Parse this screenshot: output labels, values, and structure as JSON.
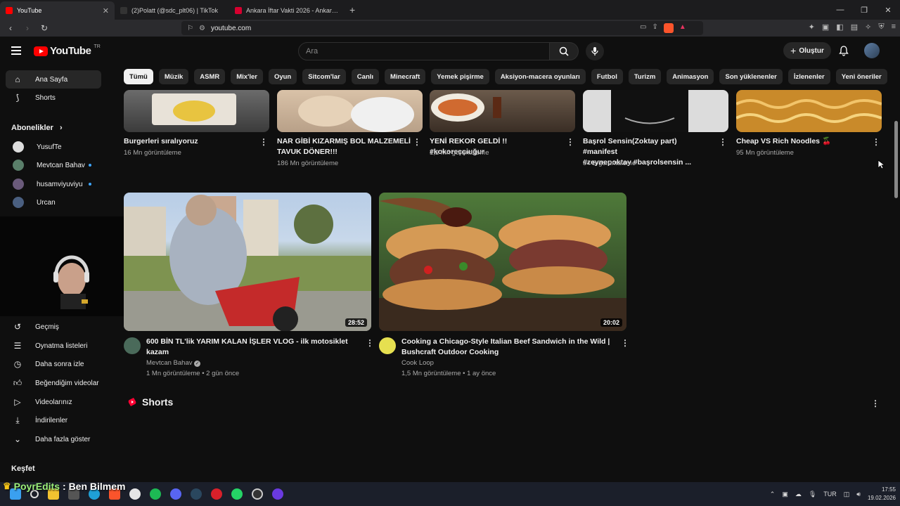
{
  "browser": {
    "tabs": [
      {
        "label": "YouTube",
        "favicon_color": "#ff0000",
        "active": true
      },
      {
        "label": "(2)Polatt (@sdc_plt06) | TikTok",
        "favicon_color": "#111111",
        "active": false
      },
      {
        "label": "Ankara İftar Vakti 2026 - Ankara İmsa...",
        "favicon_color": "#d6002f",
        "active": false
      }
    ],
    "url": "youtube.com"
  },
  "header": {
    "logo_text": "YouTube",
    "logo_region": "TR",
    "search_placeholder": "Ara",
    "create_label": "Oluştur"
  },
  "chips": [
    "Tümü",
    "Müzik",
    "ASMR",
    "Mix'ler",
    "Oyun",
    "Sitcom'lar",
    "Canlı",
    "Minecraft",
    "Yemek pişirme",
    "Aksiyon-macera oyunları",
    "Futbol",
    "Turizm",
    "Animasyon",
    "Son yüklenenler",
    "İzlenenler",
    "Yeni öneriler"
  ],
  "sidebar": {
    "main": [
      {
        "label": "Ana Sayfa",
        "icon": "home-icon"
      },
      {
        "label": "Shorts",
        "icon": "shorts-icon"
      }
    ],
    "subscriptions_heading": "Abonelikler",
    "subscriptions": [
      {
        "label": "YusufTe",
        "color": "#dddddd",
        "new": false
      },
      {
        "label": "Mevtcan Bahav",
        "color": "#5a7f6a",
        "new": true
      },
      {
        "label": "husamviyuviyu",
        "color": "#6a5a7a",
        "new": true
      },
      {
        "label": "Urcan",
        "color": "#4a5f80",
        "new": false
      }
    ],
    "you": [
      {
        "label": "Geçmiş",
        "icon": "history-icon"
      },
      {
        "label": "Oynatma listeleri",
        "icon": "playlists-icon"
      },
      {
        "label": "Daha sonra izle",
        "icon": "watch-later-icon"
      },
      {
        "label": "Beğendiğim videolar",
        "icon": "like-icon"
      },
      {
        "label": "Videolarınız",
        "icon": "your-videos-icon"
      },
      {
        "label": "İndirilenler",
        "icon": "download-icon"
      },
      {
        "label": "Daha fazla göster",
        "icon": "chevron-down-icon"
      }
    ],
    "explore_heading": "Keşfet"
  },
  "row1": [
    {
      "title": "Burgerleri sıralıyoruz",
      "title2": "",
      "meta": "16 Mn görüntüleme"
    },
    {
      "title": "NAR GİBİ KIZARMIŞ BOL MALZEMELİ",
      "title2": "TAVUK DÖNER!!!",
      "meta": "186 Mn görüntüleme"
    },
    {
      "title": "YENİ REKOR GELDİ !! #kokoreççiuğur",
      "title2": "",
      "meta": "1,2 Mn görüntüleme"
    },
    {
      "title": "Başrol Sensin(Zoktay part) #manifest",
      "title2": "#zeynepoktay #başrolsensin ...",
      "meta": "94 B görüntüleme"
    },
    {
      "title": "Cheap VS Rich Noodles 🍒",
      "title2": "",
      "meta": "95 Mn görüntüleme"
    }
  ],
  "row2": [
    {
      "title": "600 BİN TL'lik YARIM KALAN İŞLER VLOG - ilk motosiklet",
      "title2": "kazam",
      "channel": "Mevtcan Bahav",
      "verified": true,
      "meta": "1 Mn görüntüleme • 2 gün önce",
      "duration": "28:52"
    },
    {
      "title": "Cooking a Chicago-Style Italian Beef Sandwich in the Wild |",
      "title2": "Bushcraft Outdoor Cooking",
      "channel": "Cook Loop",
      "verified": false,
      "meta": "1,5 Mn görüntüleme • 1 ay önce",
      "duration": "20:02"
    }
  ],
  "shorts_heading": "Shorts",
  "overlay": {
    "name": "PoyrEdits",
    "text": ": Ben Bilmem"
  },
  "tray": {
    "lang": "TUR",
    "time": "17:55",
    "date": "19.02.2026"
  }
}
